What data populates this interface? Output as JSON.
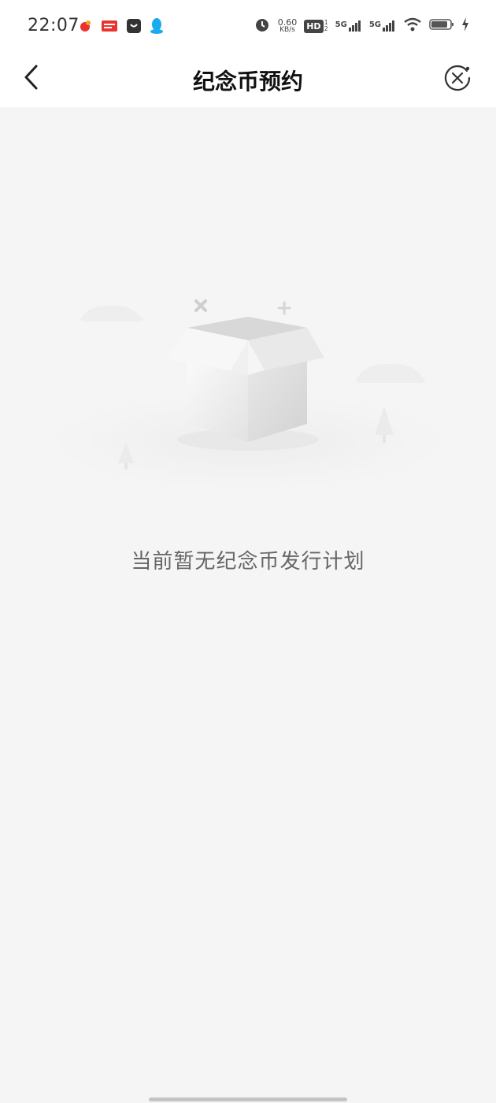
{
  "status_bar": {
    "time": "22:07",
    "net_speed_value": "0.60",
    "net_speed_unit": "KB/s",
    "hd_label": "HD",
    "sim1_label": "5G",
    "sim2_label": "5G",
    "notification_icons": [
      "weibo-icon",
      "toutiao-icon",
      "shopping-icon",
      "qq-icon"
    ],
    "right_icons": [
      "alarm-icon",
      "hd-icon",
      "signal-icon",
      "wifi-icon",
      "battery-icon",
      "charging-icon"
    ]
  },
  "nav": {
    "title": "纪念币预约",
    "back_icon": "chevron-left-icon",
    "close_icon": "close-circle-icon"
  },
  "empty_state": {
    "message": "当前暂无纪念币发行计划",
    "illustration_icon": "empty-box-icon"
  },
  "colors": {
    "background": "#f5f5f5",
    "header": "#ffffff",
    "title_text": "#111111",
    "message_text": "#666666"
  }
}
